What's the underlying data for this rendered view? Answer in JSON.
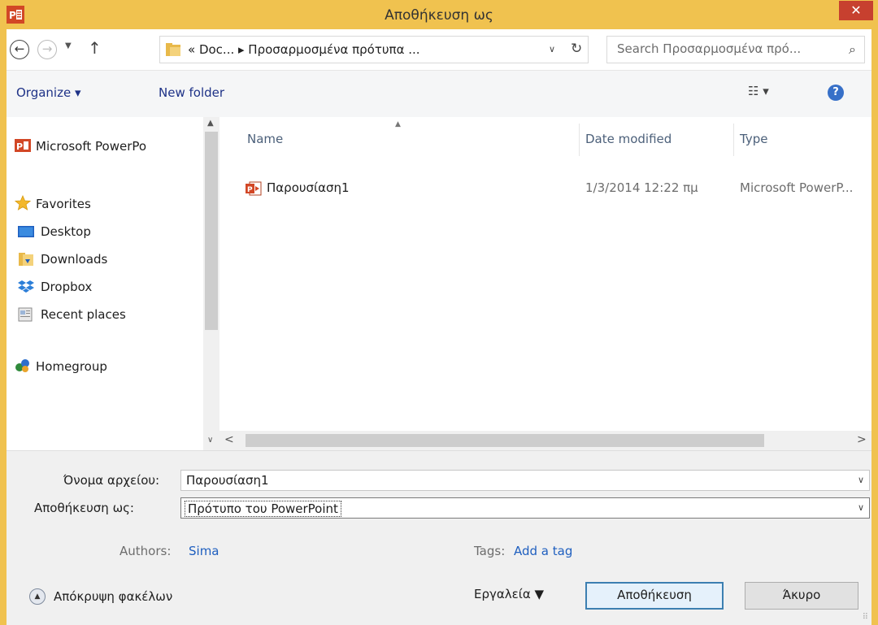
{
  "window": {
    "title": "Αποθήκευση ως",
    "close_glyph": "✕"
  },
  "address": {
    "back_glyph": "←",
    "forward_glyph": "→",
    "recent_glyph": "▼",
    "up_glyph": "↑",
    "path": "«  Doc...  ▸  Προσαρμοσμένα πρότυπα ...",
    "dropdown_glyph": "∨",
    "refresh_glyph": "↻",
    "search_placeholder": "Search Προσαρμοσμένα πρό...",
    "search_glyph": "⌕"
  },
  "toolbar": {
    "organize": "Organize ▾",
    "new_folder": "New folder",
    "views_glyph": "☷ ▾",
    "help_glyph": "?"
  },
  "navpane": {
    "items": [
      {
        "label": "Microsoft PowerPo"
      },
      {
        "label": "Favorites"
      },
      {
        "label": "Desktop"
      },
      {
        "label": "Downloads"
      },
      {
        "label": "Dropbox"
      },
      {
        "label": "Recent places"
      },
      {
        "label": "Homegroup"
      }
    ],
    "scroll_up": "▲",
    "scroll_down": "∨"
  },
  "filelist": {
    "columns": [
      "Name",
      "Date modified",
      "Type"
    ],
    "sort_glyph": "▲",
    "rows": [
      {
        "name": "Παρουσίαση1",
        "date": "1/3/2014 12:22 πμ",
        "type": "Microsoft PowerP..."
      }
    ],
    "scroll_left": "<",
    "scroll_right": ">"
  },
  "form": {
    "filename_label": "Όνομα αρχείου:",
    "filename_value": "Παρουσίαση1",
    "savetype_label": "Αποθήκευση ως:",
    "savetype_value": "Πρότυπο του PowerPoint",
    "dropdown_glyph": "∨",
    "authors_label": "Authors:",
    "authors_value": "Sima",
    "tags_label": "Tags:",
    "tags_value": "Add a tag"
  },
  "footer": {
    "hide_folders": "Απόκρυψη φακέλων",
    "hide_glyph": "▲",
    "tools": "Εργαλεία  ▼",
    "save": "Αποθήκευση",
    "cancel": "Άκυρο"
  },
  "colors": {
    "titlebar": "#f0c24f",
    "close": "#c7402f",
    "link": "#1f5fbf",
    "powerpoint": "#d24726"
  }
}
